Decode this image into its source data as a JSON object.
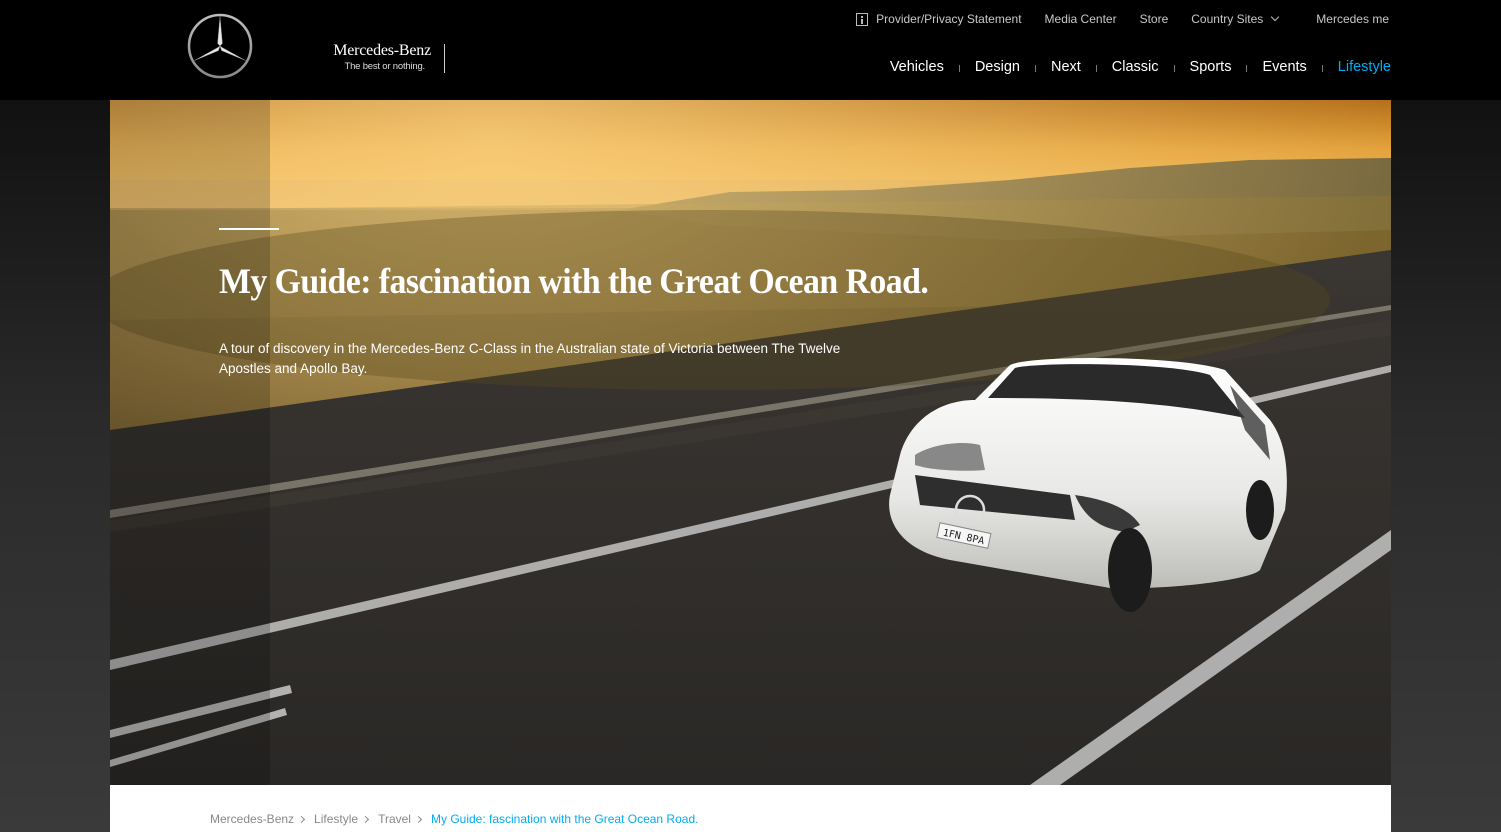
{
  "brand": {
    "name": "Mercedes-Benz",
    "tagline": "The best or nothing."
  },
  "utility_nav": {
    "provider": "Provider/Privacy Statement",
    "media": "Media Center",
    "store": "Store",
    "country": "Country Sites",
    "me": "Mercedes me"
  },
  "main_nav": {
    "vehicles": "Vehicles",
    "design": "Design",
    "next": "Next",
    "classic": "Classic",
    "sports": "Sports",
    "events": "Events",
    "lifestyle": "Lifestyle",
    "active": "Lifestyle"
  },
  "hero": {
    "title": "My Guide: fascination with the Great Ocean Road.",
    "description": "A tour of discovery in the Mercedes-Benz C-Class in the Australian state of Victoria between The Twelve Apostles and Apollo Bay.",
    "plate": "1FN 8PA"
  },
  "breadcrumb": {
    "home": "Mercedes-Benz",
    "lifestyle": "Lifestyle",
    "travel": "Travel",
    "current": "My Guide: fascination with the Great Ocean Road."
  },
  "colors": {
    "accent": "#00adef",
    "header_bg": "#000000",
    "text_light": "#ffffff"
  },
  "icons": [
    "mercedes-star-icon",
    "info-icon",
    "chevron-down-icon",
    "chevron-right-icon"
  ]
}
